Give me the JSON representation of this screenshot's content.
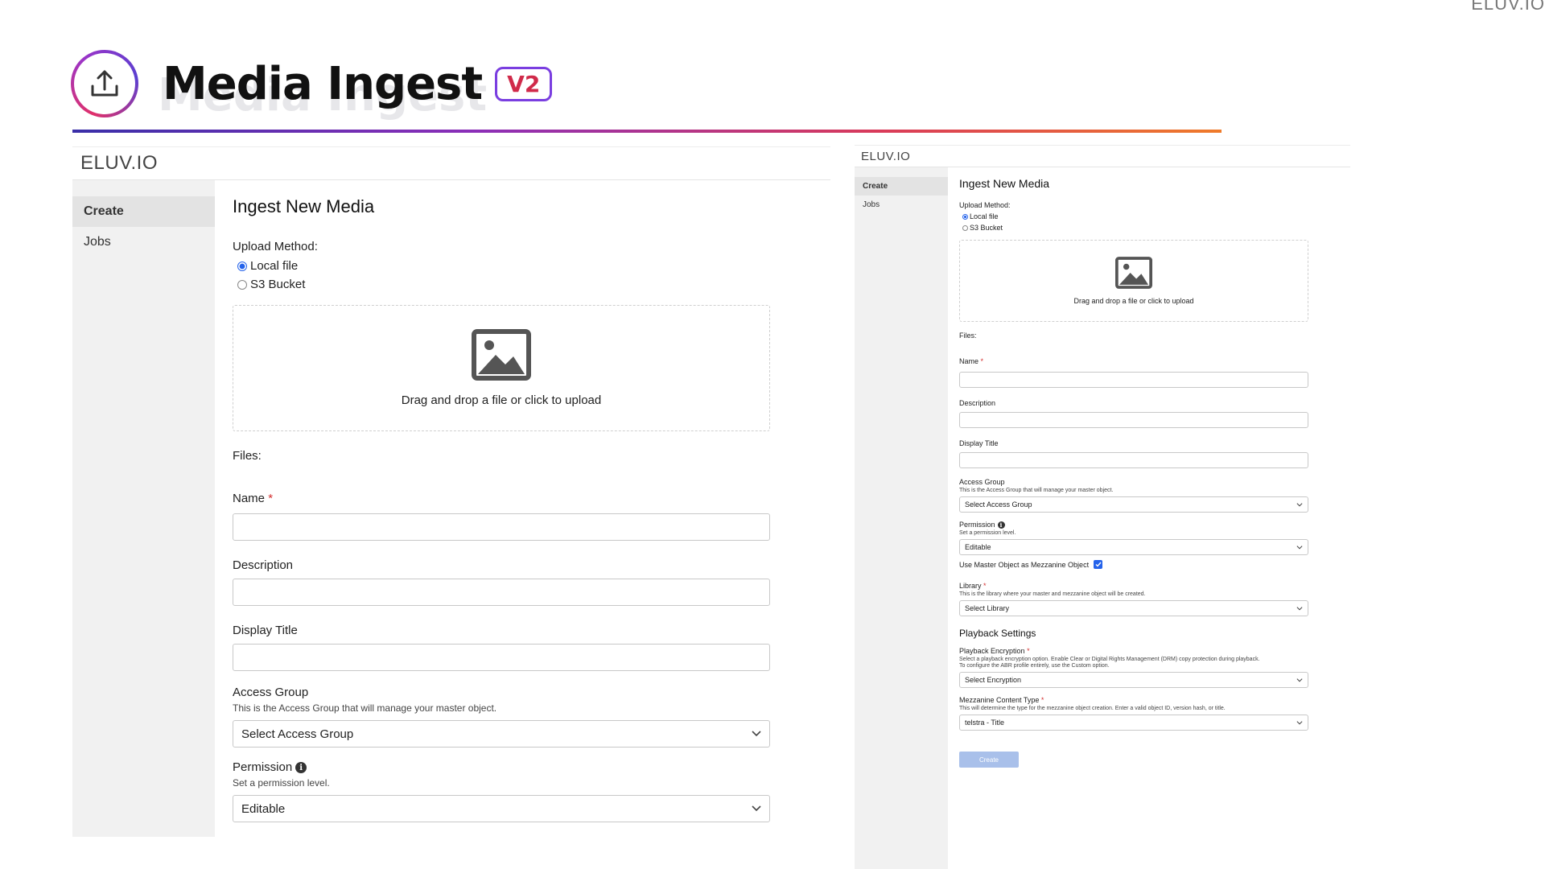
{
  "corner_logo": "ELUV.IO",
  "slide": {
    "title": "Media Ingest",
    "shadow_title": "Media Ingest",
    "version_badge": "V2"
  },
  "app": {
    "logo": "ELUV.IO",
    "nav": [
      {
        "label": "Create",
        "active": true
      },
      {
        "label": "Jobs",
        "active": false
      }
    ],
    "form_title": "Ingest New Media",
    "upload_method_label": "Upload Method:",
    "upload_options": [
      {
        "label": "Local file",
        "checked": true
      },
      {
        "label": "S3 Bucket",
        "checked": false
      }
    ],
    "dropzone_text": "Drag and drop a file or click to upload",
    "files_label": "Files:",
    "name_label": "Name",
    "required_mark": "*",
    "description_label": "Description",
    "display_title_label": "Display Title",
    "access_group_label": "Access Group",
    "access_group_help": "This is the Access Group that will manage your master object.",
    "access_group_value": "Select Access Group",
    "permission_label": "Permission",
    "permission_help": "Set a permission level.",
    "permission_value": "Editable",
    "mezzanine_checkbox_label": "Use Master Object as Mezzanine Object",
    "mezzanine_checked": true,
    "library_label": "Library",
    "library_help": "This is the library where your master and mezzanine object will be created.",
    "library_value": "Select Library",
    "playback_section": "Playback Settings",
    "encryption_label": "Playback Encryption",
    "encryption_help_1": "Select a playback encryption option. Enable Clear or Digital Rights Management (DRM) copy protection during playback.",
    "encryption_help_2": "To configure the ABR profile entirely, use the Custom option.",
    "encryption_value": "Select Encryption",
    "content_type_label": "Mezzanine Content Type",
    "content_type_help": "This will determine the type for the mezzanine object creation. Enter a valid object ID, version hash, or title.",
    "content_type_value": "telstra - Title",
    "create_button": "Create"
  },
  "colors": {
    "accent_blue": "#2563eb",
    "required_red": "#d32f2f",
    "create_button_disabled": "#a9c0ea"
  },
  "icons": [
    "upload-icon",
    "image-icon",
    "chevron-down-icon",
    "info-icon",
    "checkmark-icon"
  ]
}
